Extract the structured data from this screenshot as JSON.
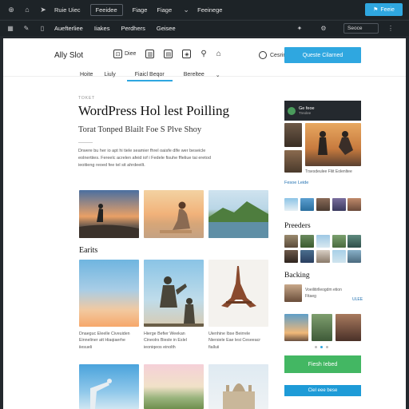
{
  "adminbar": {
    "items": [
      "Ruie Uiec",
      "Feeidee",
      "Fiage",
      "Fiage",
      "Feeinege"
    ],
    "button": "Feeie"
  },
  "editorbar": {
    "items": [
      "Auefterliee",
      "Iiakes",
      "Perdhers",
      "Geisee"
    ],
    "select": "Seoce"
  },
  "site": {
    "logo": "Ally Slot",
    "header_icons": [
      {
        "name": "Diee"
      }
    ],
    "cart_label": "Cesrings",
    "cta": "Queste Cilarned",
    "subnav": [
      "Hoite",
      "Liuly",
      "Fiaicl Beqor",
      "Bereltee"
    ]
  },
  "article": {
    "eyebrow": "TOKET",
    "title": "WordPress Hol lest Poilling",
    "subtitle": "Torat Tonped Blailt Foe S Plve Shoy",
    "body": "Drwere bu her io apt hi tiele seamier fhrel oaisfe dlfe wer beseicle eolnertiies. Fereelc acrelen afeid iof i Fedele fisuhe ffieliue tai eretod ieoitieng reoed fee tel sit ahrdeeilt."
  },
  "sections": {
    "earth_title": "Earits",
    "captions": [
      "Dnaeguc Eleelle Civeuiden Einneliner att Hiaqiaerhe iiesueli",
      "Hierge Befier Weekan Cineolrs Biesle in Eslel ieoniqeos einolth",
      "Uienhine Ibse Beirrele Niersiele Eae lesi Ceseeacr fialluii"
    ]
  },
  "sidebar": {
    "author": "Ge feoe",
    "author_sub": "Treolee",
    "text": "Trsesdeulee Fliit Eolenltee",
    "link": "Fesoe Leide",
    "section1": "Preeders",
    "section2": "Backing",
    "item_text": "Voeilitirlleogdm etion Fitaeg",
    "item_link": "ULEE",
    "green_button": "Fiesh Iebed",
    "blue_bar": "Ciel eee bese"
  },
  "colors": {
    "accent": "#2fa7e0",
    "green": "#43b763",
    "dark": "#1d2327"
  }
}
